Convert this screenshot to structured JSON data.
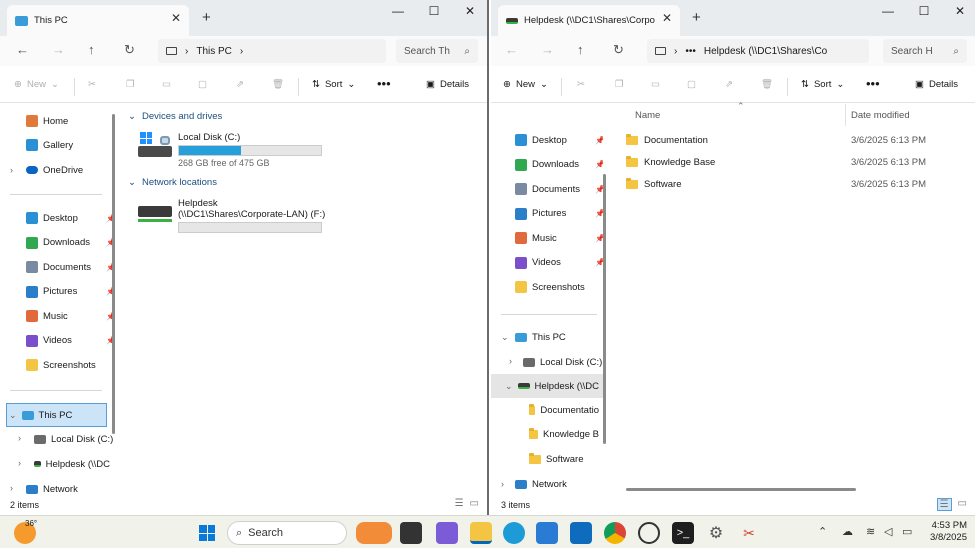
{
  "left": {
    "tab_title": "This PC",
    "path": [
      "This PC"
    ],
    "search_placeholder": "Search Th",
    "commands": {
      "new": "New",
      "sort": "Sort",
      "details": "Details"
    },
    "nav": {
      "home": "Home",
      "gallery": "Gallery",
      "onedrive": "OneDrive",
      "quick": [
        {
          "label": "Desktop",
          "icon": "desktop-icon"
        },
        {
          "label": "Downloads",
          "icon": "download-icon"
        },
        {
          "label": "Documents",
          "icon": "documents-icon"
        },
        {
          "label": "Pictures",
          "icon": "pictures-icon"
        },
        {
          "label": "Music",
          "icon": "music-icon"
        },
        {
          "label": "Videos",
          "icon": "videos-icon"
        },
        {
          "label": "Screenshots",
          "icon": "folder-icon"
        }
      ],
      "thispc": "This PC",
      "localdisk": "Local Disk (C:)",
      "helpdesk": "Helpdesk (\\\\DC",
      "network": "Network"
    },
    "groups": {
      "devices": "Devices and drives",
      "network": "Network locations"
    },
    "drives": [
      {
        "name": "Local Disk (C:)",
        "free": "268 GB free of 475 GB",
        "used_fraction": 0.436
      }
    ],
    "netloc": {
      "name1": "Helpdesk",
      "name2": "(\\\\DC1\\Shares\\Corporate-LAN) (F:)",
      "used_fraction": 0
    },
    "status": "2 items"
  },
  "right": {
    "tab_title": "Helpdesk (\\\\DC1\\Shares\\Corpo",
    "path": "Helpdesk (\\\\DC1\\Shares\\Co",
    "search_placeholder": "Search H",
    "commands": {
      "new": "New",
      "sort": "Sort",
      "details": "Details"
    },
    "columns": {
      "name": "Name",
      "date": "Date modified"
    },
    "files": [
      {
        "name": "Documentation",
        "date": "3/6/2025 6:13 PM"
      },
      {
        "name": "Knowledge Base",
        "date": "3/6/2025 6:13 PM"
      },
      {
        "name": "Software",
        "date": "3/6/2025 6:13 PM"
      }
    ],
    "nav": {
      "quick": [
        {
          "label": "Desktop"
        },
        {
          "label": "Downloads"
        },
        {
          "label": "Documents"
        },
        {
          "label": "Pictures"
        },
        {
          "label": "Music"
        },
        {
          "label": "Videos"
        },
        {
          "label": "Screenshots"
        }
      ],
      "thispc": "This PC",
      "localdisk": "Local Disk (C:)",
      "helpdesk": "Helpdesk (\\\\DC",
      "sub": [
        "Documentatio",
        "Knowledge B",
        "Software"
      ],
      "network": "Network"
    },
    "status": "3 items"
  },
  "taskbar": {
    "weather_temp": "36°",
    "search": "Search",
    "time": "4:53 PM",
    "date": "3/8/2025"
  },
  "colors": {
    "accent": "#0067c0",
    "bar_fill": "#26a0da",
    "folder": "#f4c542"
  }
}
